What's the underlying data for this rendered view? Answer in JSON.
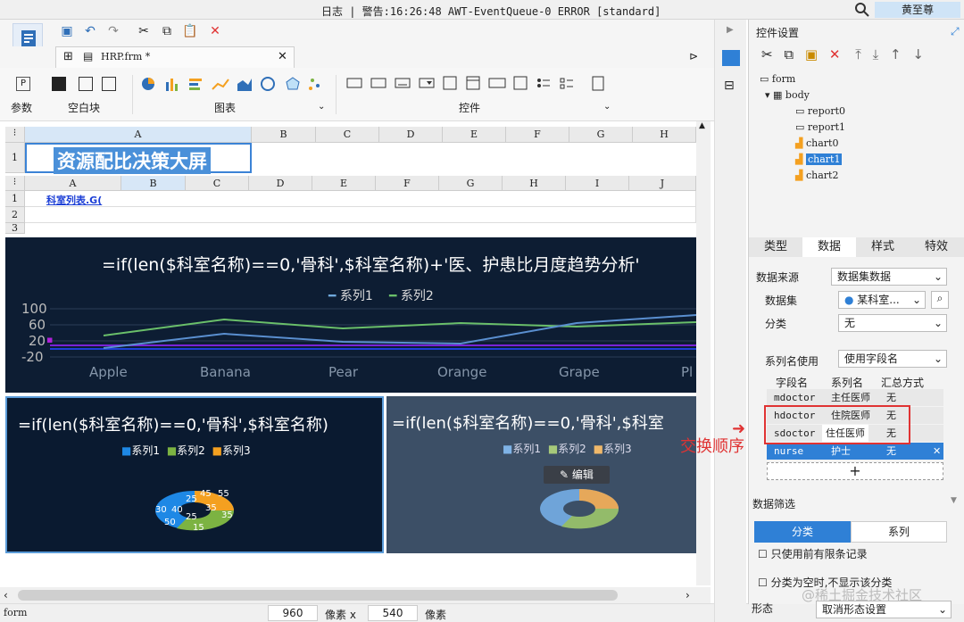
{
  "topbar": {
    "log": "日志 | 警告:16:26:48 AWT-EventQueue-0 ERROR [standard]",
    "user": "黄至尊"
  },
  "file_tab": {
    "name": "HRP.frm *"
  },
  "groups": {
    "param": "参数",
    "blank": "空白块",
    "chart": "图表",
    "control": "控件"
  },
  "sheet1": {
    "cols": [
      "A",
      "B",
      "C",
      "D",
      "E",
      "F",
      "G",
      "H"
    ],
    "row": "1",
    "title": "资源配比决策大屏"
  },
  "sheet2": {
    "cols": [
      "A",
      "B",
      "C",
      "D",
      "E",
      "F",
      "G",
      "H",
      "I",
      "J"
    ],
    "rows": [
      "1",
      "2",
      "3"
    ],
    "a1": "科室列表.G("
  },
  "chart0": {
    "title": "=if(len($科室名称)==0,'骨科',$科室名称)+'医、护患比月度趋势分析'",
    "legend": [
      "系列1",
      "系列2"
    ],
    "yticks": [
      "100",
      "60",
      "20",
      "-20"
    ],
    "xticks": [
      "Apple",
      "Banana",
      "Pear",
      "Orange",
      "Grape",
      "Pl"
    ]
  },
  "chart1": {
    "title": "=if(len($科室名称)==0,'骨科',$科室名称)",
    "legend": [
      "系列1",
      "系列2",
      "系列3"
    ]
  },
  "chart2": {
    "title": "=if(len($科室名称)==0,'骨科',$科室",
    "legend": [
      "系列1",
      "系列2",
      "系列3"
    ],
    "edit": "编辑"
  },
  "donut_labels": [
    "45",
    "55",
    "25",
    "35",
    "40",
    "30",
    "35",
    "25",
    "50",
    "15"
  ],
  "right": {
    "header": "控件设置",
    "tree": [
      "form",
      "body",
      "report0",
      "report1",
      "chart0",
      "chart1",
      "chart2"
    ],
    "tabs": [
      "类型",
      "数据",
      "样式",
      "特效"
    ],
    "data_source_label": "数据来源",
    "data_source": "数据集数据",
    "dataset_label": "数据集",
    "dataset": "某科室...",
    "category_label": "分类",
    "category": "无",
    "series_name_label": "系列名使用",
    "series_name": "使用字段名",
    "table_headers": [
      "字段名",
      "系列名",
      "汇总方式"
    ],
    "rows": [
      [
        "mdoctor",
        "主任医师",
        "无"
      ],
      [
        "hdoctor",
        "住院医师",
        "无"
      ],
      [
        "sdoctor",
        "住任医师",
        "无"
      ],
      [
        "nurse",
        "护士",
        "无"
      ]
    ],
    "add": "+",
    "filter_label": "数据筛选",
    "filter_tabs": [
      "分类",
      "系列"
    ],
    "check1": "只使用前有限条记录",
    "check2": "分类为空时,不显示该分类",
    "form_label": "形态",
    "form_value": "取消形态设置"
  },
  "annotation": "交换顺序",
  "watermark": "@稀土掘金技术社区",
  "status": {
    "left": "form",
    "w": "960",
    "unit1": "像素 x",
    "h": "540",
    "unit2": "像素"
  },
  "colors": {
    "blue": "#1e88e5",
    "green": "#7cb342",
    "orange": "#f4a020",
    "red": "#e03333"
  }
}
